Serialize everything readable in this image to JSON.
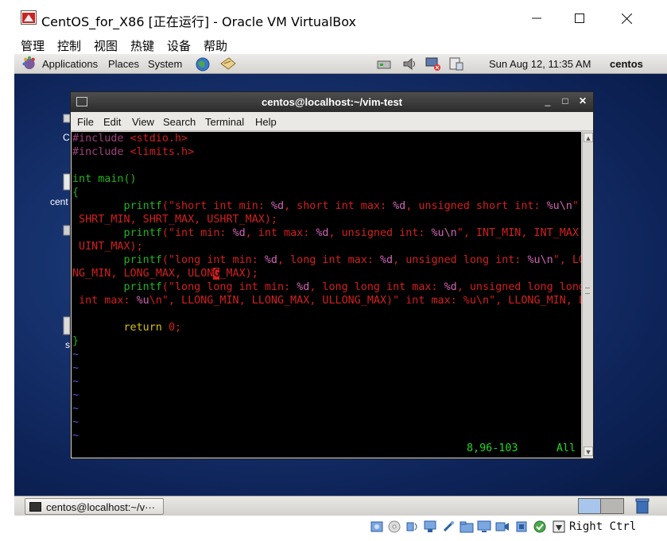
{
  "window": {
    "title": "CentOS_for_X86 [正在运行] - Oracle VM VirtualBox",
    "controls": [
      "minimize",
      "maximize",
      "close"
    ]
  },
  "vbox_menu": [
    "管理",
    "控制",
    "视图",
    "热键",
    "设备",
    "帮助"
  ],
  "gnome_top_panel": {
    "menus": [
      "Applications",
      "Places",
      "System"
    ],
    "clock": "Sun Aug 12, 11:35 AM",
    "user": "centos"
  },
  "desktop_labels": [
    "C",
    "cent",
    "s"
  ],
  "terminal": {
    "title": "centos@localhost:~/vim-test",
    "menu": [
      "File",
      "Edit",
      "View",
      "Search",
      "Terminal",
      "Help"
    ],
    "lines": [
      "#include <stdio.h>",
      "#include <limits.h>",
      "",
      "int main()",
      "{",
      "        printf(\"short int min: %d, short int max: %d, unsigned short int: %u\\n\",",
      " SHRT_MIN, SHRT_MAX, USHRT_MAX);",
      "        printf(\"int min: %d, int max: %d, unsigned int: %u\\n\", INT_MIN, INT_MAX,",
      " UINT_MAX);",
      "        printf(\"long int min: %d, long int max: %d, unsigned long int: %u\\n\", LO",
      "NG_MIN, LONG_MAX, ULONG_MAX);",
      "        printf(\"long long int min: %d, long long int max: %d, unsigned long long",
      " int max: %u\\n\", LLONG_MIN, LLONG_MAX, ULLONG_MAX);",
      "",
      "        return 0;",
      "}"
    ],
    "tildes": [
      "~",
      "~",
      "~",
      "~",
      "~",
      "~",
      "~",
      "~"
    ],
    "status_position": "8,96-103",
    "status_scroll": "All"
  },
  "taskbar": {
    "task_label": "centos@localhost:~/v···"
  },
  "vbox_status": {
    "host_key": "Right Ctrl"
  }
}
